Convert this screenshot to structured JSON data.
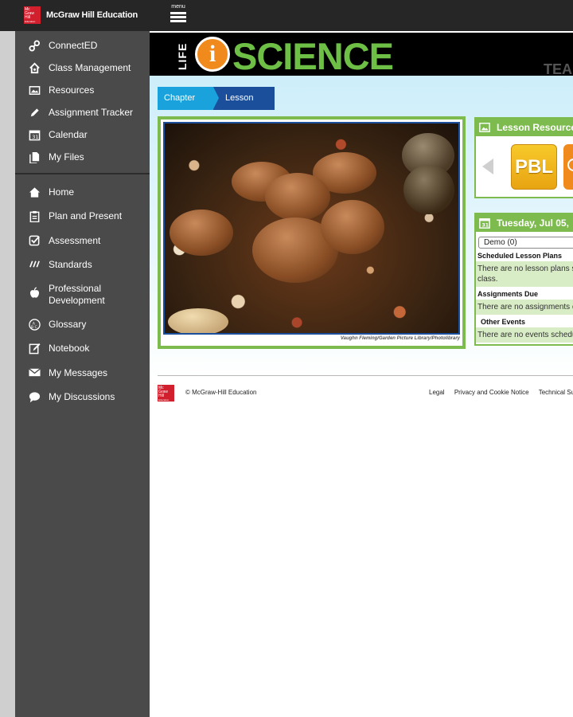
{
  "topbar": {
    "brand": "McGraw Hill Education",
    "logo_text": [
      "Mc",
      "Graw",
      "Hill",
      "Education"
    ],
    "menu_label": "menu"
  },
  "sidebar": {
    "group1": [
      {
        "label": "ConnectED",
        "icon": "link-icon"
      },
      {
        "label": "Class Management",
        "icon": "house-icon"
      },
      {
        "label": "Resources",
        "icon": "image-icon"
      },
      {
        "label": "Assignment Tracker",
        "icon": "pencil-icon"
      },
      {
        "label": "Calendar",
        "icon": "calendar-icon"
      },
      {
        "label": "My Files",
        "icon": "files-icon"
      }
    ],
    "group2": [
      {
        "label": "Home",
        "icon": "home-icon"
      },
      {
        "label": "Plan and Present",
        "icon": "clipboard-icon"
      },
      {
        "label": "Assessment",
        "icon": "checkbox-icon"
      },
      {
        "label": "Standards",
        "icon": "slashes-icon"
      },
      {
        "label": "Professional Development",
        "icon": "apple-icon"
      },
      {
        "label": "Glossary",
        "icon": "abc-icon"
      },
      {
        "label": "Notebook",
        "icon": "notebook-icon"
      },
      {
        "label": "My Messages",
        "icon": "envelope-icon"
      },
      {
        "label": "My Discussions",
        "icon": "speech-bubble-icon"
      }
    ]
  },
  "banner": {
    "life": "LIFE",
    "i": "i",
    "science": "SCIENCE",
    "teacher_fragment": "TEA"
  },
  "breadcrumb": {
    "chapter": "Chapter 1:...",
    "lesson": "Lesson 1:..."
  },
  "photo": {
    "credit": "Vaughn Fleming/Garden Picture Library/Photolibrary"
  },
  "lesson_resources": {
    "title": "Lesson Resources",
    "pbl_label": "PBL"
  },
  "calendar": {
    "date": "Tuesday, Jul 05,",
    "select_value": "Demo (0)",
    "scheduled_label": "Scheduled Lesson Plans",
    "scheduled_msg_line1": "There are no lesson plans s",
    "scheduled_msg_line2": "class.",
    "assignments_label": "Assignments Due",
    "assignments_msg": "There are no assignments d",
    "other_label": "Other Events",
    "other_msg": "There are no events schedu"
  },
  "footer": {
    "copyright": "© McGraw-Hill Education",
    "legal": "Legal",
    "privacy": "Privacy and Cookie Notice",
    "support": "Technical Sup"
  },
  "colors": {
    "accent_green": "#7dbb4e",
    "brand_red": "#d11f2d",
    "crumb_blue": "#1aa2dc",
    "crumb_dark_blue": "#1b4f9c",
    "sidebar_bg": "#4a4a4a"
  }
}
